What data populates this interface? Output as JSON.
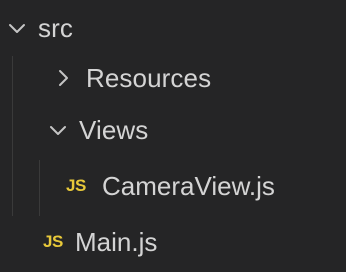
{
  "explorer": {
    "root_folder": {
      "label": "src",
      "expanded": true,
      "chevron_icon": "chevron-down-icon"
    },
    "folders": [
      {
        "label": "Resources",
        "expanded": false,
        "chevron_icon": "chevron-right-icon"
      },
      {
        "label": "Views",
        "expanded": true,
        "chevron_icon": "chevron-down-icon"
      }
    ],
    "files": [
      {
        "badge": "JS",
        "label": "CameraView.js",
        "icon": "javascript-file-icon"
      },
      {
        "badge": "JS",
        "label": "Main.js",
        "icon": "javascript-file-icon"
      }
    ]
  },
  "colors": {
    "background": "#252526",
    "text": "#d4d4d4",
    "chevron": "#c5c5c5",
    "js_badge": "#e8c93a"
  }
}
